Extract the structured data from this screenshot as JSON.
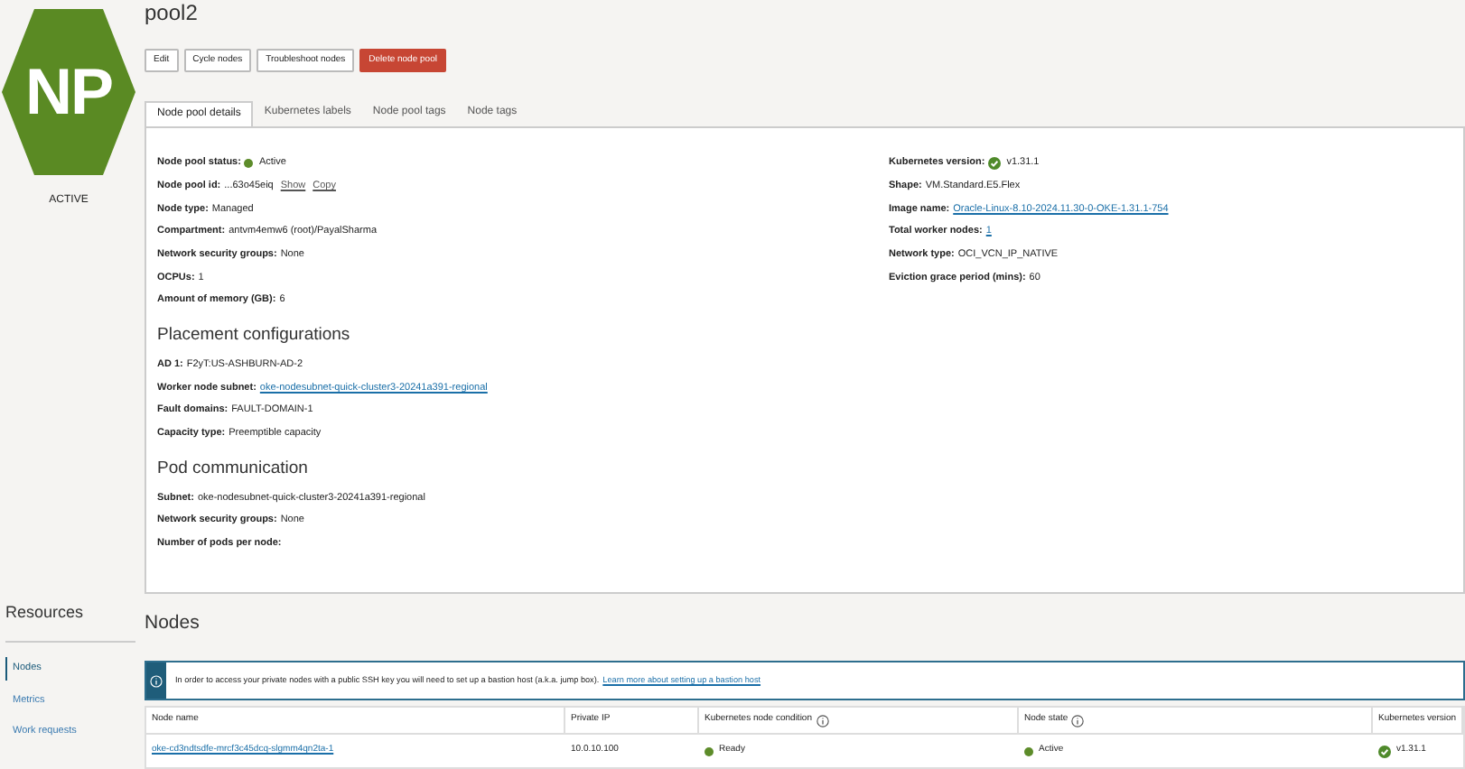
{
  "pool": {
    "badge": "NP",
    "status": "ACTIVE",
    "name": "pool2"
  },
  "actions": [
    {
      "label": "Edit",
      "kind": "default"
    },
    {
      "label": "Cycle nodes",
      "kind": "default"
    },
    {
      "label": "Troubleshoot nodes",
      "kind": "default"
    },
    {
      "label": "Delete node pool",
      "kind": "danger"
    }
  ],
  "tabs": [
    {
      "label": "Node pool details",
      "selected": true
    },
    {
      "label": "Kubernetes labels",
      "selected": false
    },
    {
      "label": "Node pool tags",
      "selected": false
    },
    {
      "label": "Node tags",
      "selected": false
    }
  ],
  "details": {
    "left": [
      {
        "label": "Node pool status:",
        "value": "Active",
        "kind": "status"
      },
      {
        "label": "Node pool id:",
        "value": "...63o45eiq",
        "kind": "id",
        "actions": [
          "Show",
          "Copy"
        ]
      },
      {
        "label": "Node type:",
        "value": "Managed",
        "kind": "text"
      },
      {
        "label": "Compartment:",
        "value": "antvm4emw6 (root)/PayalSharma",
        "kind": "text"
      },
      {
        "label": "Network security groups:",
        "value": "None",
        "kind": "text"
      },
      {
        "label": "OCPUs:",
        "value": "1",
        "kind": "text"
      },
      {
        "label": "Amount of memory (GB):",
        "value": "6",
        "kind": "text"
      }
    ],
    "right": [
      {
        "label": "Kubernetes version:",
        "value": "v1.31.1",
        "kind": "version"
      },
      {
        "label": "Shape:",
        "value": "VM.Standard.E5.Flex",
        "kind": "text"
      },
      {
        "label": "Image name:",
        "value": "Oracle-Linux-8.10-2024.11.30-0-OKE-1.31.1-754",
        "kind": "link"
      },
      {
        "label": "Total worker nodes:",
        "value": "1",
        "kind": "link"
      },
      {
        "label": "Network type:",
        "value": "OCI_VCN_IP_NATIVE",
        "kind": "text"
      },
      {
        "label": "Eviction grace period (mins):",
        "value": "60",
        "kind": "text"
      }
    ]
  },
  "sections": [
    {
      "title": "Placement configurations",
      "fields": [
        {
          "label": "AD 1:",
          "value": "F2yT:US-ASHBURN-AD-2",
          "kind": "text"
        },
        {
          "label": "Worker node subnet:",
          "value": "oke-nodesubnet-quick-cluster3-20241a391-regional",
          "kind": "link"
        },
        {
          "label": "Fault domains:",
          "value": "FAULT-DOMAIN-1",
          "kind": "text"
        },
        {
          "label": "Capacity type:",
          "value": "Preemptible capacity",
          "kind": "text"
        }
      ]
    },
    {
      "title": "Pod communication",
      "fields": [
        {
          "label": "Subnet:",
          "value": "oke-nodesubnet-quick-cluster3-20241a391-regional",
          "kind": "text"
        },
        {
          "label": "Network security groups:",
          "value": "None",
          "kind": "text"
        },
        {
          "label": "Number of pods per node:"
        }
      ]
    }
  ],
  "resources": {
    "title": "Resources",
    "items": [
      {
        "label": "Nodes",
        "selected": true
      },
      {
        "label": "Metrics",
        "selected": false
      },
      {
        "label": "Work requests",
        "selected": false
      }
    ]
  },
  "nodes": {
    "title": "Nodes",
    "notice": {
      "text": "In order to access your private nodes with a public SSH key you will need to set up a bastion host (a.k.a. jump box).",
      "link": "Learn more about setting up a bastion host"
    },
    "columns": [
      {
        "label": "Node name",
        "info": false
      },
      {
        "label": "Private IP",
        "info": false
      },
      {
        "label": "Kubernetes node condition",
        "info": true
      },
      {
        "label": "Node state",
        "info": true
      },
      {
        "label": "Kubernetes version",
        "info": false
      }
    ],
    "rows": [
      [
        {
          "text": "oke-cd3ndtsdfe-mrcf3c45dcq-slgmm4qn2ta-1",
          "kind": "link"
        },
        {
          "text": "10.0.10.100",
          "kind": "text"
        },
        {
          "text": "Ready",
          "kind": "status"
        },
        {
          "text": "Active",
          "kind": "status"
        },
        {
          "text": "v1.31.1",
          "kind": "version"
        }
      ]
    ]
  }
}
